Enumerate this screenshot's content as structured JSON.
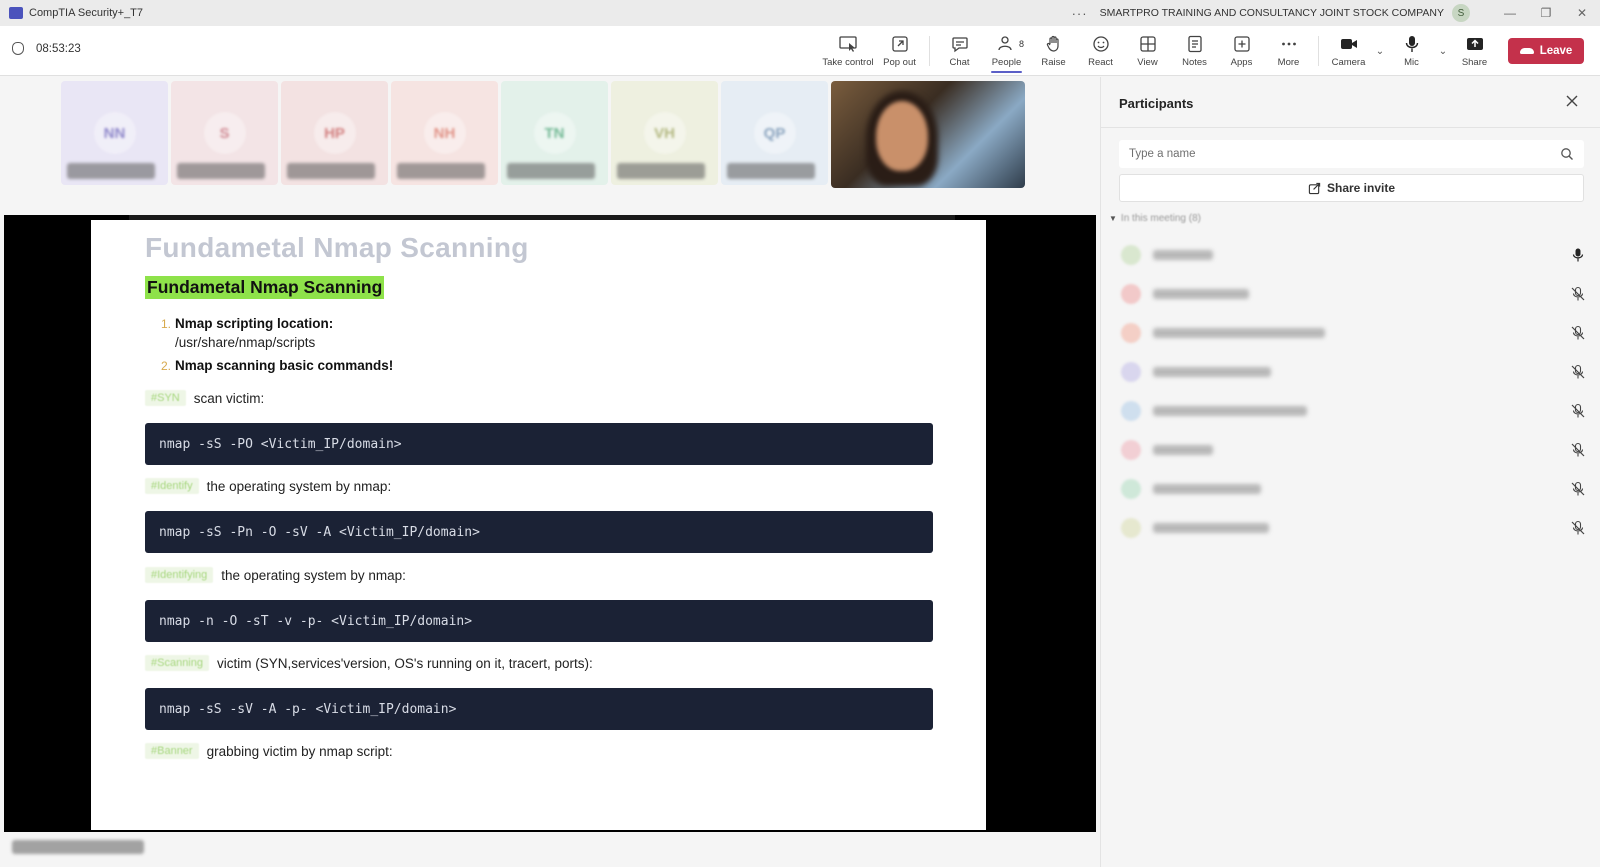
{
  "window": {
    "title": "CompTIA Security+_T7",
    "more_label": "···",
    "org_name": "SMARTPRO TRAINING AND CONSULTANCY JOINT STOCK COMPANY",
    "org_avatar": "S",
    "minimize": "—",
    "restore": "❐",
    "close": "✕"
  },
  "toolbar": {
    "timer": "08:53:23",
    "items": [
      {
        "label": "Take control",
        "icon": "take-control-icon"
      },
      {
        "label": "Pop out",
        "icon": "pop-out-icon"
      },
      {
        "label": "Chat",
        "icon": "chat-icon"
      },
      {
        "label": "People",
        "icon": "people-icon",
        "badge": "8",
        "active": true
      },
      {
        "label": "Raise",
        "icon": "raise-hand-icon"
      },
      {
        "label": "React",
        "icon": "react-icon"
      },
      {
        "label": "View",
        "icon": "view-icon"
      },
      {
        "label": "Notes",
        "icon": "notes-icon"
      },
      {
        "label": "Apps",
        "icon": "apps-icon"
      },
      {
        "label": "More",
        "icon": "more-icon"
      },
      {
        "label": "Camera",
        "icon": "camera-icon"
      },
      {
        "label": "Mic",
        "icon": "mic-icon"
      },
      {
        "label": "Share",
        "icon": "share-icon"
      }
    ],
    "leave_label": "Leave",
    "leave_color": "#c4314b"
  },
  "video_tiles": [
    {
      "initials": "NN",
      "bg": "#e9e6f5",
      "fg": "#8d86c9"
    },
    {
      "initials": "S",
      "bg": "#f3e4e6",
      "fg": "#d08a94"
    },
    {
      "initials": "HP",
      "bg": "#f3e2e2",
      "fg": "#d28080"
    },
    {
      "initials": "NH",
      "bg": "#f6e4e2",
      "fg": "#e09286"
    },
    {
      "initials": "TN",
      "bg": "#e3f1ea",
      "fg": "#72b894"
    },
    {
      "initials": "VH",
      "bg": "#eef0e0",
      "fg": "#b2b780"
    },
    {
      "initials": "QP",
      "bg": "#e6edf4",
      "fg": "#8aa3be"
    }
  ],
  "slide": {
    "title": "Fundametal Nmap Scanning",
    "highlighted_title": "Fundametal Nmap Scanning",
    "list": [
      {
        "num": "1.",
        "text": "Nmap scripting location:",
        "sub": "/usr/share/nmap/scripts"
      },
      {
        "num": "2.",
        "text": "Nmap scanning basic commands!"
      }
    ],
    "sections": [
      {
        "tag": "#SYN",
        "text": "scan victim:",
        "code": "nmap -sS -PO <Victim_IP/domain>"
      },
      {
        "tag": "#Identify",
        "text": "the operating system by nmap:",
        "code": "nmap -sS -Pn -O -sV -A <Victim_IP/domain>"
      },
      {
        "tag": "#Identifying",
        "text": "the operating system by nmap:",
        "code": "nmap -n -O -sT -v -p- <Victim_IP/domain>"
      },
      {
        "tag": "#Scanning",
        "text": "victim (SYN,services'version, OS's running on it, tracert, ports):",
        "code": "nmap -sS -sV -A -p- <Victim_IP/domain>"
      },
      {
        "tag": "#Banner",
        "text": "grabbing victim by nmap script:"
      }
    ]
  },
  "participants_panel": {
    "title": "Participants",
    "search_placeholder": "Type a name",
    "share_invite_label": "Share invite",
    "section_label": "In this meeting (8)",
    "participants": [
      {
        "avatar_color": "#d9e7cf",
        "mic": "on"
      },
      {
        "avatar_color": "#f2c9c9",
        "mic": "muted"
      },
      {
        "avatar_color": "#f4cfc6",
        "mic": "muted"
      },
      {
        "avatar_color": "#d9d6ee",
        "mic": "muted"
      },
      {
        "avatar_color": "#cfdfee",
        "mic": "muted"
      },
      {
        "avatar_color": "#f2cfd4",
        "mic": "muted"
      },
      {
        "avatar_color": "#cfe8d9",
        "mic": "muted"
      },
      {
        "avatar_color": "#e6e8cf",
        "mic": "muted"
      }
    ]
  }
}
